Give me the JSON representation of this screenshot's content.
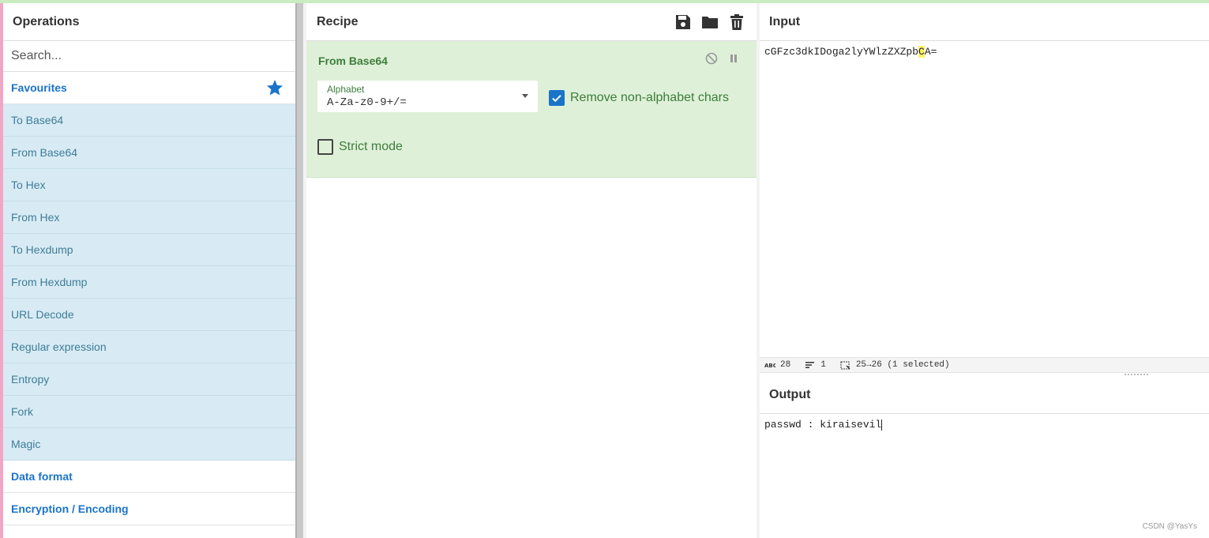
{
  "operations": {
    "title": "Operations",
    "search_placeholder": "Search...",
    "favourites_label": "Favourites",
    "items": [
      {
        "label": "To Base64"
      },
      {
        "label": "From Base64"
      },
      {
        "label": "To Hex"
      },
      {
        "label": "From Hex"
      },
      {
        "label": "To Hexdump"
      },
      {
        "label": "From Hexdump"
      },
      {
        "label": "URL Decode"
      },
      {
        "label": "Regular expression"
      },
      {
        "label": "Entropy"
      },
      {
        "label": "Fork"
      },
      {
        "label": "Magic"
      }
    ],
    "categories": [
      {
        "label": "Data format"
      },
      {
        "label": "Encryption / Encoding"
      }
    ]
  },
  "recipe": {
    "title": "Recipe",
    "operation": {
      "title": "From Base64",
      "alphabet_label": "Alphabet",
      "alphabet_value": "A-Za-z0-9+/=",
      "remove_non_alphabet_label": "Remove non-alphabet chars",
      "remove_non_alphabet_checked": true,
      "strict_mode_label": "Strict mode",
      "strict_mode_checked": false
    }
  },
  "input": {
    "title": "Input",
    "text_before": "cGFzc3dkIDoga2lyYWlzZXZpb",
    "text_highlight": "C",
    "text_after": "A=",
    "status_length": "28",
    "status_lines": "1",
    "status_selection": "25→26 (1 selected)"
  },
  "output": {
    "title": "Output",
    "text": "passwd : kiraisevil"
  },
  "watermark": "CSDN @YasYs",
  "colors": {
    "accent": "#1a74c9",
    "op_card_bg": "#dff0d8",
    "op_item_bg": "#d8ebf4",
    "highlight": "#fff36b"
  }
}
